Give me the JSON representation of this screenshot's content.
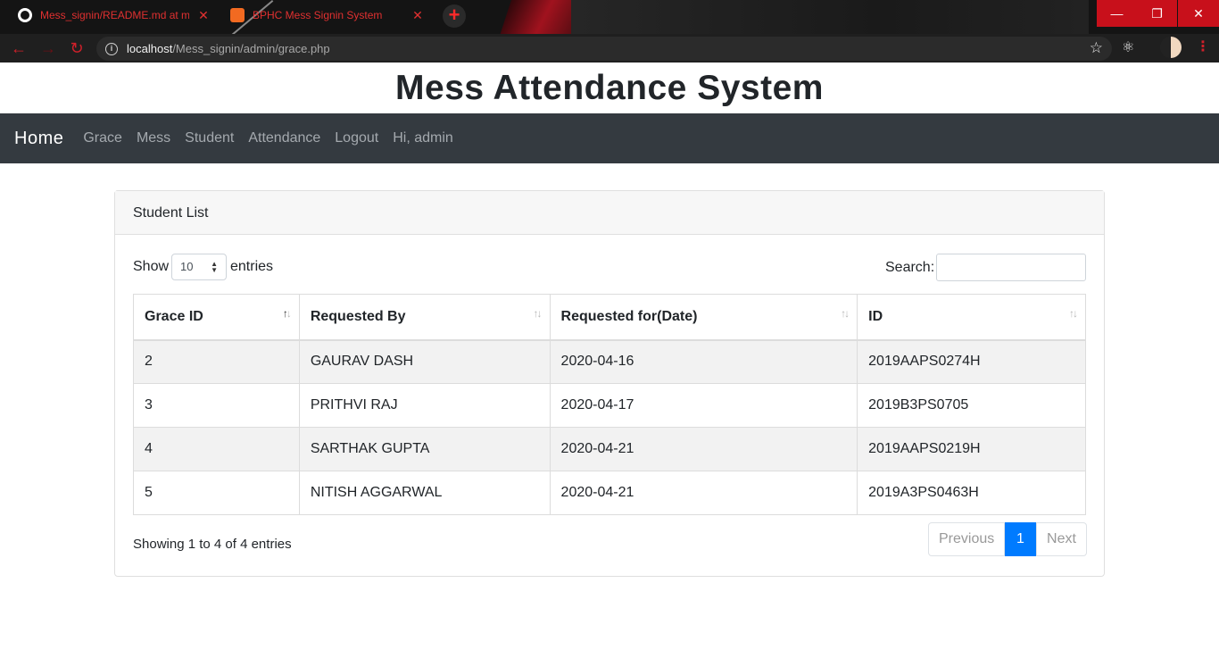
{
  "browser": {
    "tabs": [
      {
        "title": "Mess_signin/README.md at master",
        "close": "✕"
      },
      {
        "title": "BPHC Mess Signin System",
        "close": "✕"
      }
    ],
    "new_tab": "+",
    "url_host": "localhost",
    "url_path": "/Mess_signin/admin/grace.php",
    "controls": {
      "minimize": "—",
      "restore": "❐",
      "close": "✕"
    }
  },
  "page": {
    "title": "Mess Attendance System",
    "navbar": {
      "brand": "Home",
      "links": [
        "Grace",
        "Mess",
        "Student",
        "Attendance",
        "Logout",
        "Hi, admin"
      ]
    },
    "card": {
      "header": "Student List",
      "show_label": "Show",
      "length_value": "10",
      "entries_label": "entries",
      "search_label": "Search:",
      "search_value": "",
      "columns": [
        "Grace ID",
        "Requested By",
        "Requested for(Date)",
        "ID"
      ],
      "rows": [
        [
          "2",
          "GAURAV DASH",
          "2020-04-16",
          "2019AAPS0274H"
        ],
        [
          "3",
          "PRITHVI RAJ",
          "2020-04-17",
          "2019B3PS0705"
        ],
        [
          "4",
          "SARTHAK GUPTA",
          "2020-04-21",
          "2019AAPS0219H"
        ],
        [
          "5",
          "NITISH AGGARWAL",
          "2020-04-21",
          "2019A3PS0463H"
        ]
      ],
      "info": "Showing 1 to 4 of 4 entries",
      "pagination": {
        "previous": "Previous",
        "current": "1",
        "next": "Next"
      }
    }
  },
  "colors": {
    "navbar": "#343a40",
    "accent": "#007bff",
    "browser_accent": "#c8101b"
  }
}
